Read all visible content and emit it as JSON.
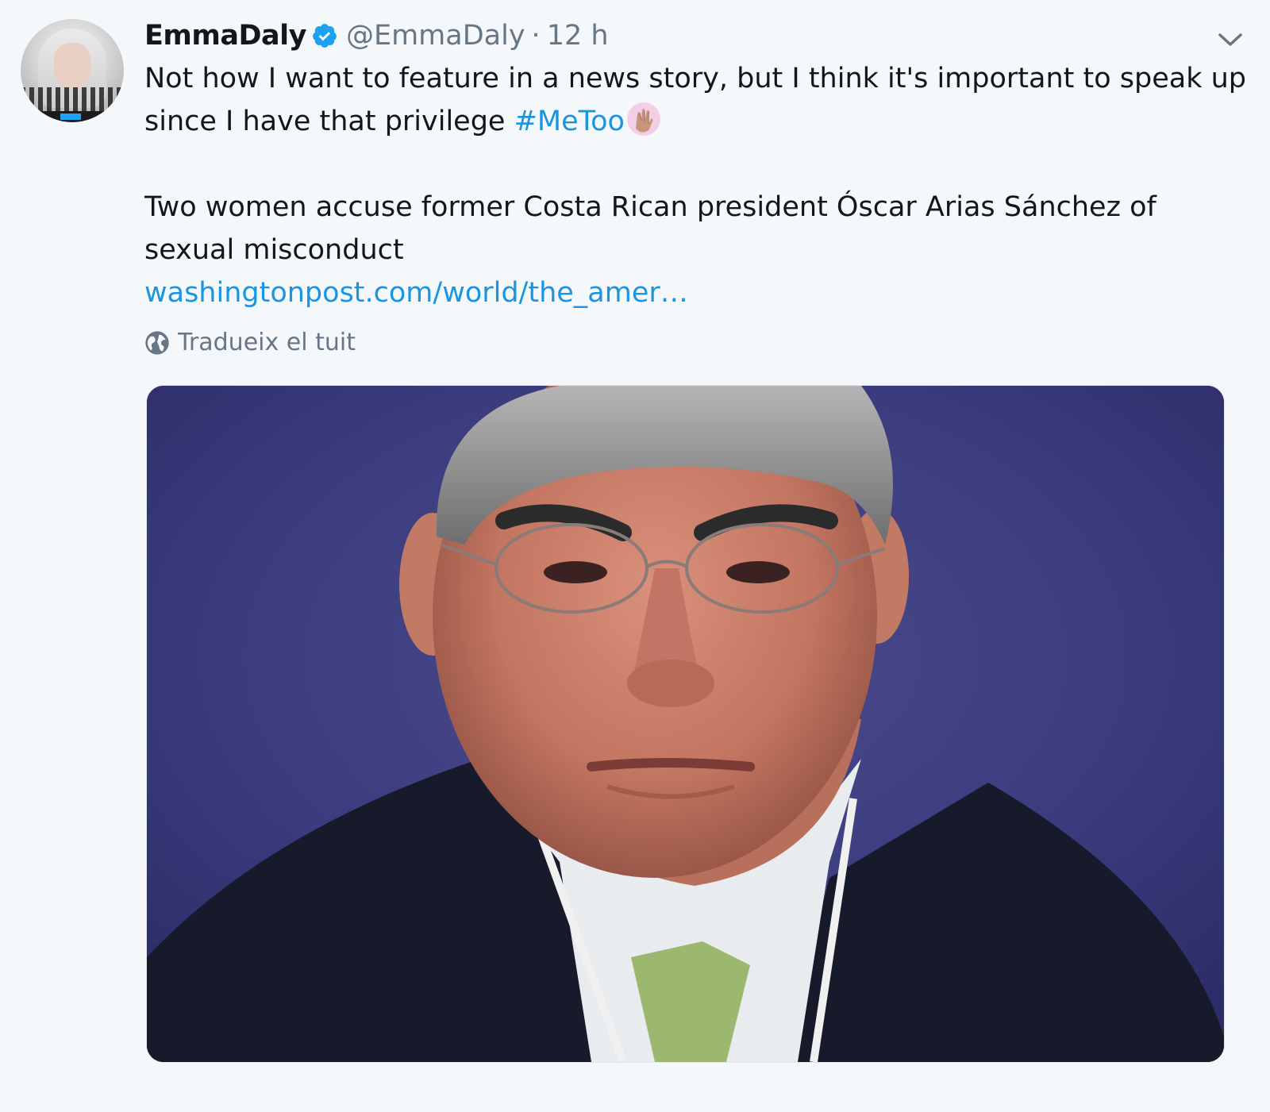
{
  "tweet": {
    "display_name": "EmmaDaly",
    "handle": "@EmmaDaly",
    "separator": "·",
    "time": "12 h",
    "text_line1_before": "Not how I want to feature in a news story, but I think it's important to speak up since I have that privilege ",
    "hashtag": "#MeToo",
    "headline": "Two women accuse former Costa Rican president Óscar Arias Sánchez of sexual misconduct",
    "link": "washingtonpost.com/world/the_amer…",
    "translate_label": "Tradueix el tuit"
  },
  "icons": {
    "verified": "verified-badge-icon",
    "menu": "chevron-down-icon",
    "translate": "globe-icon",
    "emoji": "raised-hands-emoji"
  },
  "colors": {
    "background": "#f5f8fa",
    "text": "#14171a",
    "secondary": "#657786",
    "link": "#1b95e0",
    "verified": "#1da1f2"
  }
}
